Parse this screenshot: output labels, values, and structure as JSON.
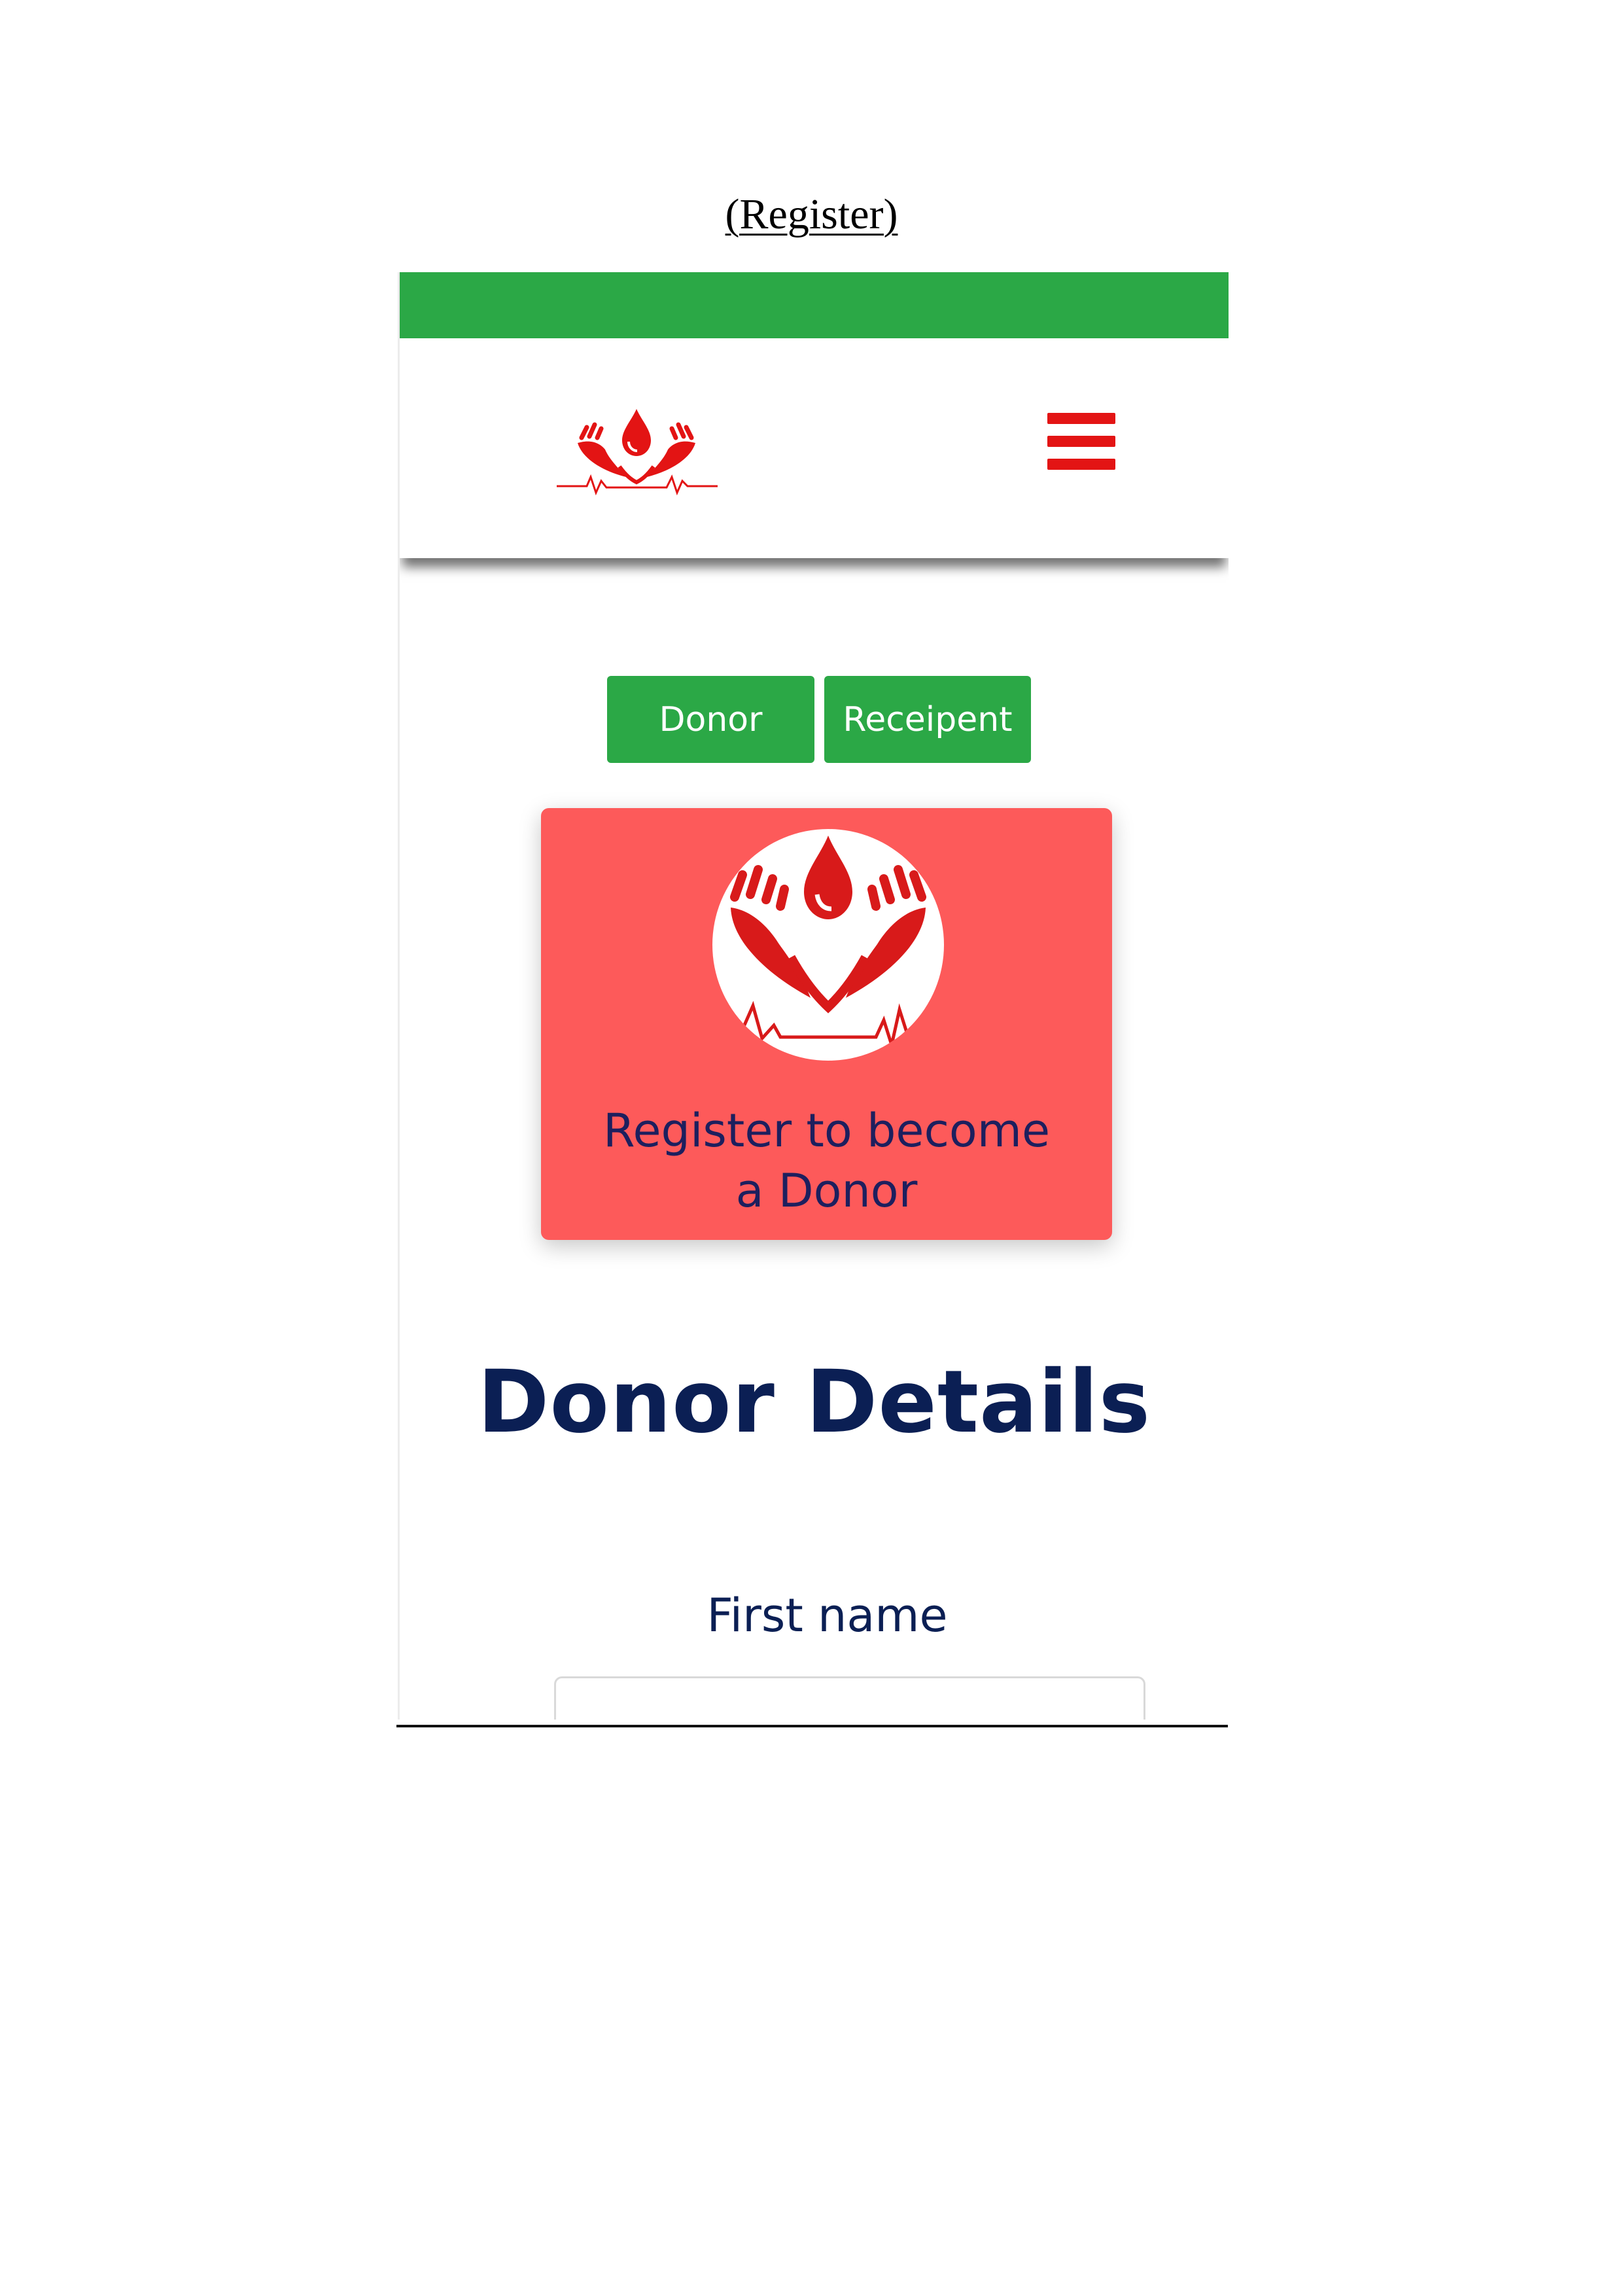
{
  "document": {
    "caption": "(Register)"
  },
  "colors": {
    "brand_green": "#2ba846",
    "card_red": "#fd5a5a",
    "logo_red": "#e31414",
    "heading_navy": "#0b1f54",
    "card_text_navy": "#1d1f5e"
  },
  "header": {
    "logo_icon": "blood-drop-hands-logo",
    "menu_icon": "hamburger-menu-icon"
  },
  "tabs": [
    {
      "label": "Donor"
    },
    {
      "label": "Receipent"
    }
  ],
  "register_card": {
    "emblem_icon": "blood-drop-hands-logo",
    "title_line1": "Register to become",
    "title_line2": "a Donor"
  },
  "form": {
    "section_title": "Donor Details",
    "fields": [
      {
        "label": "First name",
        "value": "",
        "placeholder": ""
      }
    ]
  }
}
